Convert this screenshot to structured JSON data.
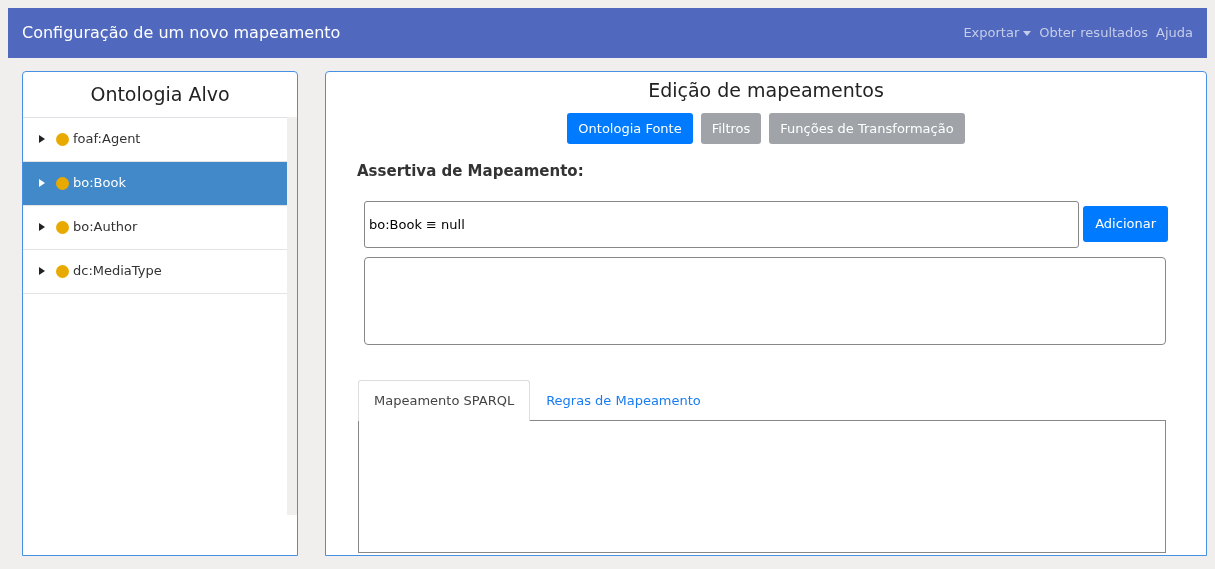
{
  "navbar": {
    "title": "Configuração de um novo mapeamento",
    "menu": [
      {
        "label": "Exportar",
        "kind": "dropdown"
      },
      {
        "label": "Obter resultados",
        "kind": "link"
      },
      {
        "label": "Ajuda",
        "kind": "link"
      }
    ]
  },
  "target_panel": {
    "title": "Ontologia Alvo",
    "items": [
      {
        "label": "foaf:Agent",
        "color": "#e8a900",
        "selected": false,
        "expanded": false
      },
      {
        "label": "bo:Book",
        "color": "#e8a900",
        "selected": true,
        "expanded": false
      },
      {
        "label": "bo:Author",
        "color": "#e8a900",
        "selected": false,
        "expanded": false
      },
      {
        "label": "dc:MediaType",
        "color": "#e8a900",
        "selected": false,
        "expanded": false
      }
    ]
  },
  "editor": {
    "title": "Edição de mapeamentos",
    "buttons": [
      {
        "label": "Ontologia Fonte",
        "selected": true
      },
      {
        "label": "Filtros",
        "selected": false
      },
      {
        "label": "Funções de Transformação",
        "selected": false
      }
    ],
    "assertion_label": "Assertiva de Mapeamento:",
    "assertion_value": "bo:Book ≡ null",
    "add_button": "Adicionar",
    "tabs": [
      {
        "label": "Mapeamento SPARQL",
        "selected": true
      },
      {
        "label": "Regras de Mapeamento",
        "selected": false
      }
    ]
  }
}
